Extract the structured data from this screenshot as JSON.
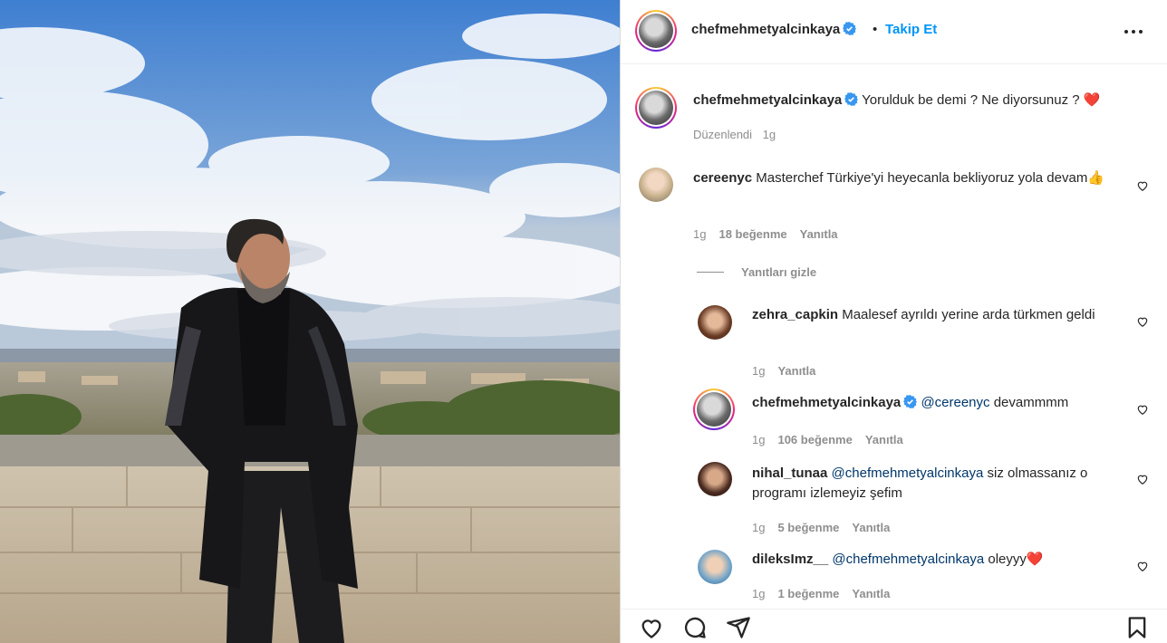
{
  "post": {
    "author": "chefmehmetyalcinkaya",
    "separator": "•",
    "follow_label": "Takip Et",
    "more_label": "•••",
    "caption_author": "chefmehmetyalcinkaya",
    "caption_text": "Yorulduk be demi ? Ne diyorsunuz ?",
    "caption_emoji": "❤️",
    "edited_label": "Düzenlendi",
    "edited_time": "1g"
  },
  "comments": [
    {
      "user": "cereenyc",
      "text": "Masterchef Türkiye'yi heyecanla bekliyoruz yola devam👍",
      "time": "1g",
      "likes": "18 beğenme",
      "reply": "Yanıtla",
      "hide_replies": "Yanıtları gizle",
      "replies": [
        {
          "user": "zehra_capkin",
          "text": "Maalesef ayrıldı yerine arda türkmen geldi",
          "time": "1g",
          "likes": "",
          "reply": "Yanıtla"
        },
        {
          "user": "chefmehmetyalcinkaya",
          "mention": "@cereenyc",
          "text": "devammmm",
          "time": "1g",
          "likes": "106 beğenme",
          "reply": "Yanıtla"
        },
        {
          "user": "nihal_tunaa",
          "mention": "@chefmehmetyalcinkaya",
          "text": "siz olmassanız o programı izlemeyiz şefim",
          "time": "1g",
          "likes": "5 beğenme",
          "reply": "Yanıtla"
        },
        {
          "user": "dileksImz__",
          "mention": "@chefmehmetyalcinkaya",
          "text": "oleyyy❤️",
          "time": "1g",
          "likes": "1 beğenme",
          "reply": "Yanıtla"
        }
      ]
    }
  ],
  "actions": {
    "like": "heart-icon",
    "comment": "comment-icon",
    "share": "share-icon",
    "save": "bookmark-icon"
  },
  "colors": {
    "link_blue": "#0095f6",
    "mention": "#00376b",
    "muted": "#8e8e8e",
    "verified": "#3897f0"
  }
}
